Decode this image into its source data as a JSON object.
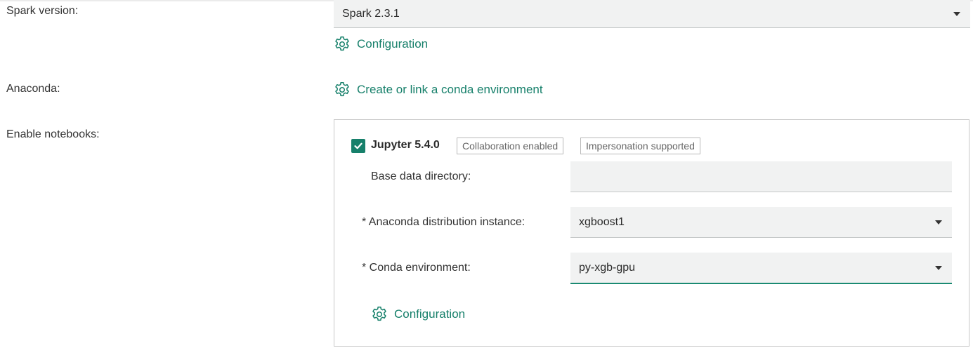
{
  "spark": {
    "label": "Spark version:",
    "selected": "Spark 2.3.1",
    "config_link": "Configuration"
  },
  "anaconda": {
    "label": "Anaconda:",
    "link": "Create or link a conda environment"
  },
  "notebooks": {
    "label": "Enable notebooks:",
    "jupyter": {
      "checked": true,
      "name": "Jupyter 5.4.0",
      "tags": [
        "Collaboration enabled",
        "Impersonation supported"
      ],
      "base_dir_label": "Base data directory:",
      "base_dir_value": "",
      "instance_label": "* Anaconda distribution instance:",
      "instance_value": "xgboost1",
      "env_label": "* Conda environment:",
      "env_value": "py-xgb-gpu",
      "config_link": "Configuration"
    }
  },
  "colors": {
    "accent": "#17806b",
    "field_bg": "#f1f2f2"
  }
}
